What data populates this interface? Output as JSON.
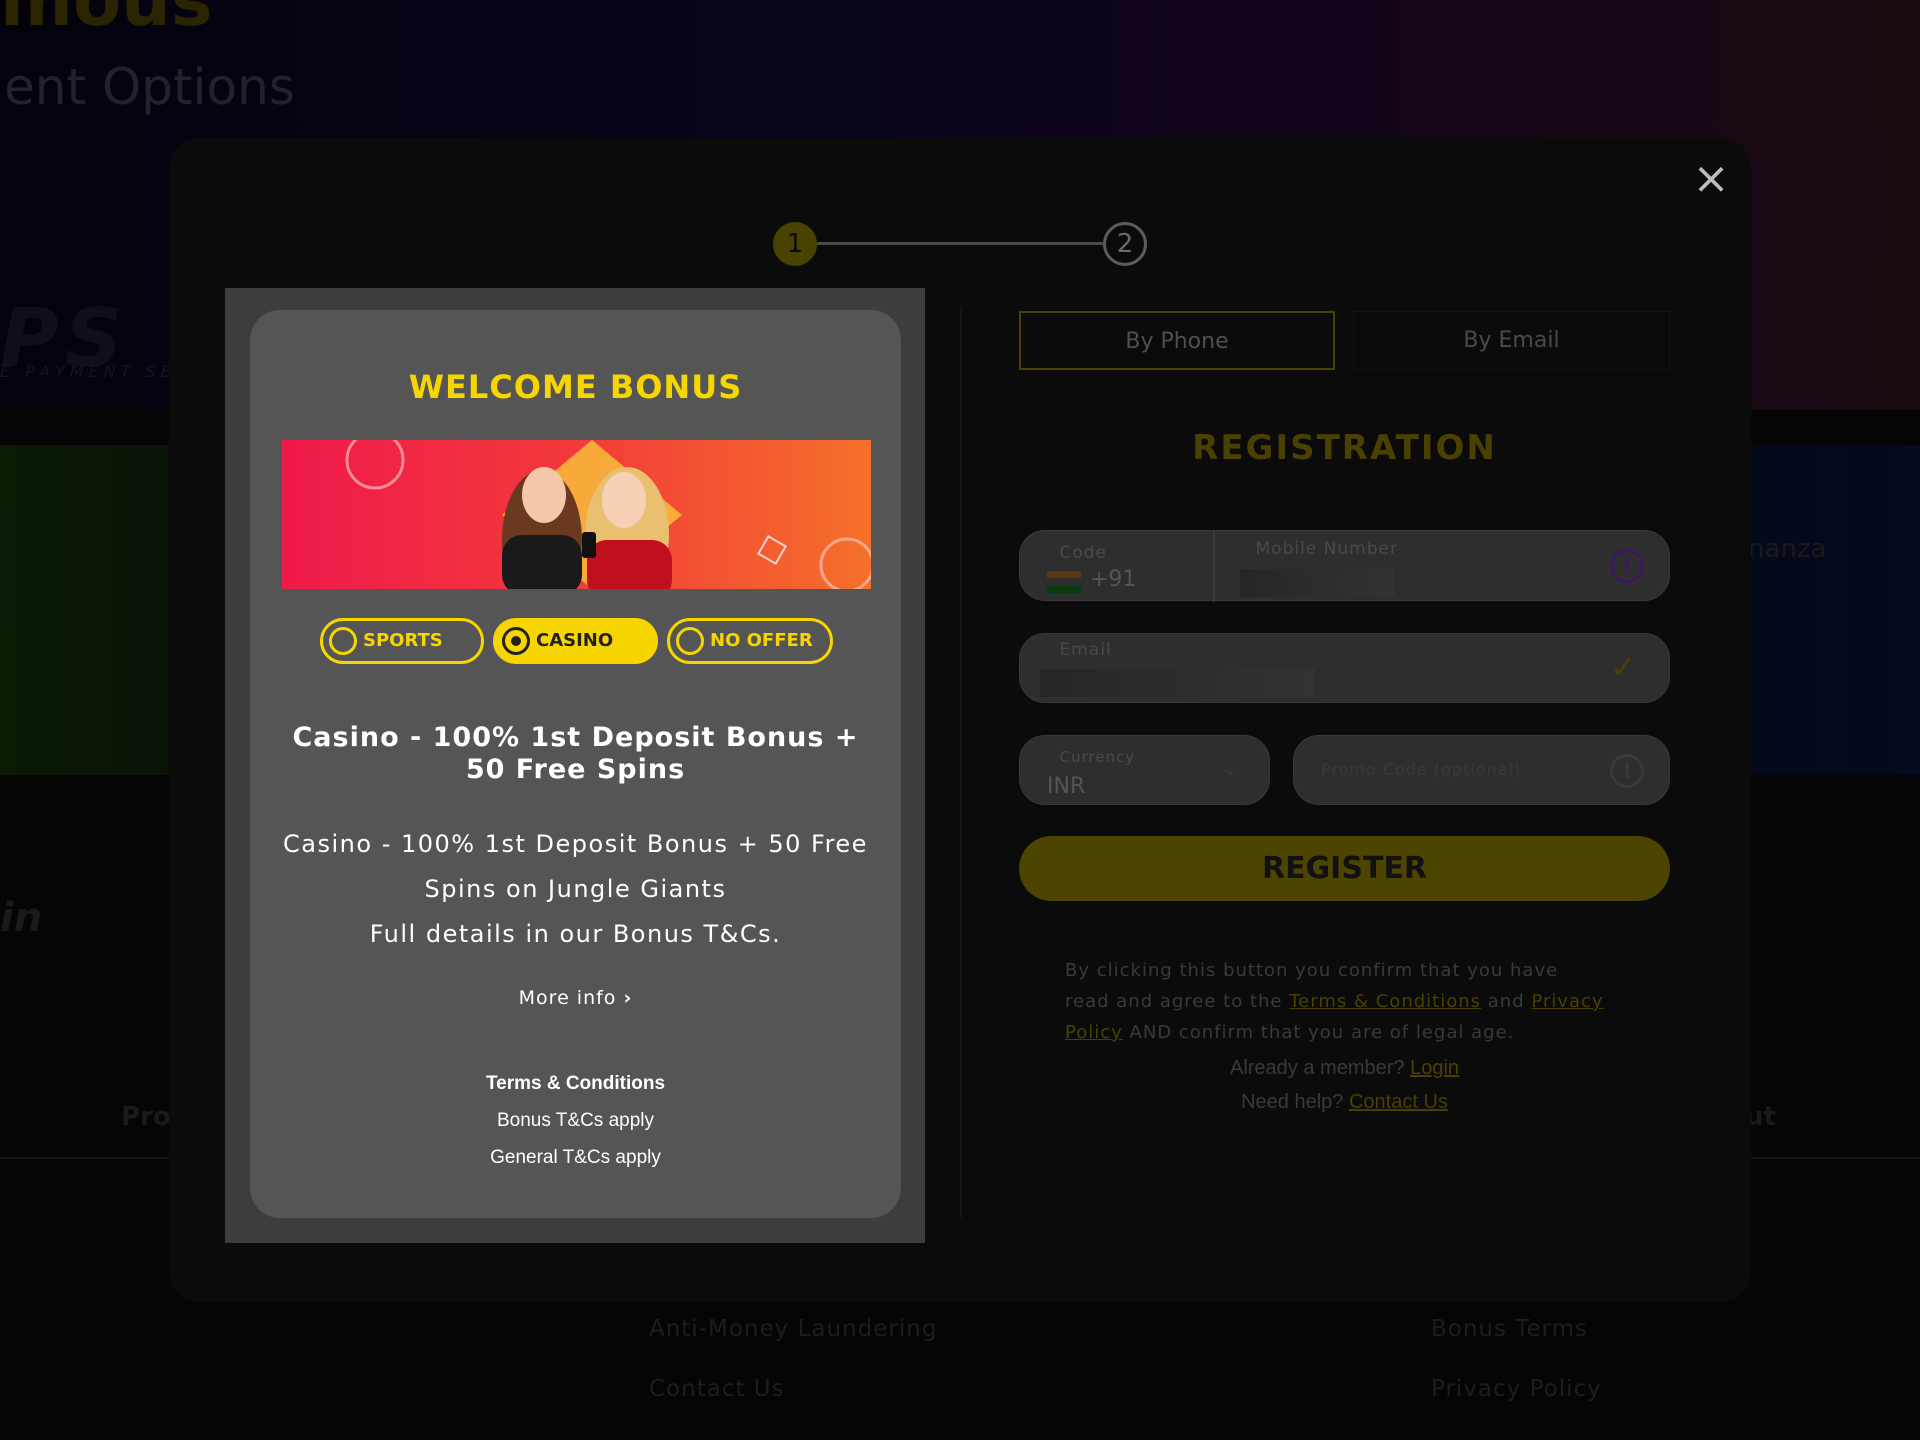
{
  "background": {
    "hero_title_fragment": "mous",
    "hero_subtitle_fragment": "ent Options",
    "logo_fragment": "PS",
    "logo_sub_fragment": "E PAYMENT SERV",
    "side_text_right": "nanza",
    "side_text_left": "in",
    "nav_left_fragment": "Proc",
    "nav_right_fragment": "ut",
    "footer_links": [
      "Anti-Money Laundering",
      "Bonus Terms",
      "Contact Us",
      "Privacy Policy"
    ]
  },
  "modal": {
    "close_icon": "close-icon",
    "steps": [
      "1",
      "2"
    ],
    "active_step": 1,
    "bonus": {
      "title": "WELCOME BONUS",
      "options": [
        {
          "label": "SPORTS",
          "selected": false
        },
        {
          "label": "CASINO",
          "selected": true
        },
        {
          "label": "NO OFFER",
          "selected": false
        }
      ],
      "offer_title": "Casino - 100% 1st Deposit Bonus + 50 Free Spins",
      "offer_desc_1": "Casino - 100% 1st Deposit Bonus + 50 Free Spins on Jungle Giants",
      "offer_desc_2": "Full details in our Bonus T&Cs.",
      "more_info": "More info",
      "terms_heading": "Terms & Conditions",
      "terms_lines": [
        "Bonus T&Cs apply",
        "General T&Cs apply"
      ]
    },
    "registration": {
      "tabs": [
        {
          "label": "By Phone",
          "active": true
        },
        {
          "label": "By Email",
          "active": false
        }
      ],
      "title": "REGISTRATION",
      "code_label": "Code",
      "code_value": "+91",
      "mobile_label": "Mobile Number",
      "email_label": "Email",
      "currency_label": "Currency",
      "currency_value": "INR",
      "promo_placeholder": "Promo Code (optional)",
      "register_label": "REGISTER",
      "legal_1": "By clicking this button you confirm that you have read and agree to the",
      "terms_link": "Terms & Conditions",
      "legal_and": "and",
      "privacy_link": "Privacy Policy",
      "legal_2": "AND confirm that you are of legal age.",
      "member_text": "Already a member?",
      "login_link": "Login",
      "help_text": "Need help?",
      "contact_link": "Contact Us"
    },
    "colors": {
      "accent": "#f7d600",
      "warning": "#6a2aa8"
    }
  }
}
